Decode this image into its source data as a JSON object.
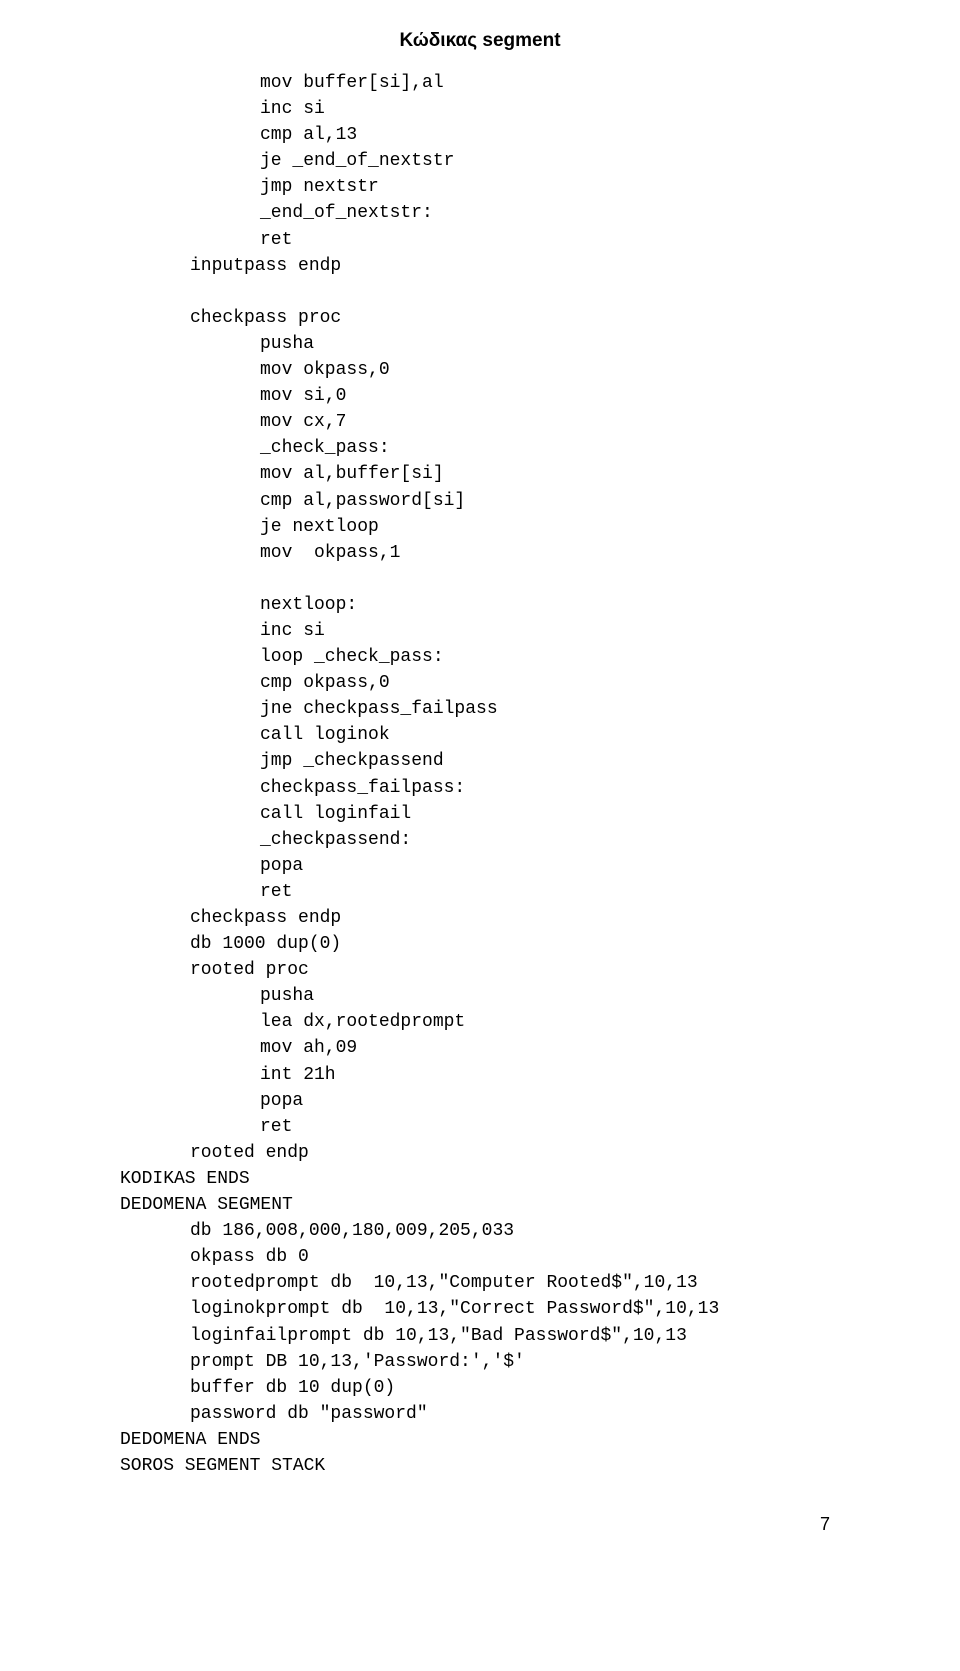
{
  "title": "Κώδικας segment",
  "lines": [
    {
      "cls": "indent2",
      "text": "mov buffer[si],al"
    },
    {
      "cls": "indent2",
      "text": "inc si"
    },
    {
      "cls": "indent2",
      "text": "cmp al,13"
    },
    {
      "cls": "indent2",
      "text": "je _end_of_nextstr"
    },
    {
      "cls": "indent2",
      "text": "jmp nextstr"
    },
    {
      "cls": "indent2",
      "text": "_end_of_nextstr:"
    },
    {
      "cls": "indent2",
      "text": "ret"
    },
    {
      "cls": "indent1",
      "text": "inputpass endp"
    },
    {
      "cls": "indent1",
      "text": ""
    },
    {
      "cls": "indent1",
      "text": "checkpass proc"
    },
    {
      "cls": "indent2",
      "text": "pusha"
    },
    {
      "cls": "indent2",
      "text": "mov okpass,0"
    },
    {
      "cls": "indent2",
      "text": "mov si,0"
    },
    {
      "cls": "indent2",
      "text": "mov cx,7"
    },
    {
      "cls": "indent2",
      "text": "_check_pass:"
    },
    {
      "cls": "indent2",
      "text": "mov al,buffer[si]"
    },
    {
      "cls": "indent2",
      "text": "cmp al,password[si]"
    },
    {
      "cls": "indent2",
      "text": "je nextloop"
    },
    {
      "cls": "indent2",
      "text": "mov  okpass,1"
    },
    {
      "cls": "indent2",
      "text": ""
    },
    {
      "cls": "indent2",
      "text": "nextloop:"
    },
    {
      "cls": "indent2",
      "text": "inc si"
    },
    {
      "cls": "indent2",
      "text": "loop _check_pass:"
    },
    {
      "cls": "indent2",
      "text": "cmp okpass,0"
    },
    {
      "cls": "indent2",
      "text": "jne checkpass_failpass"
    },
    {
      "cls": "indent2",
      "text": "call loginok"
    },
    {
      "cls": "indent2",
      "text": "jmp _checkpassend"
    },
    {
      "cls": "indent2",
      "text": "checkpass_failpass:"
    },
    {
      "cls": "indent2",
      "text": "call loginfail"
    },
    {
      "cls": "indent2",
      "text": "_checkpassend:"
    },
    {
      "cls": "indent2",
      "text": "popa"
    },
    {
      "cls": "indent2",
      "text": "ret"
    },
    {
      "cls": "indent1",
      "text": "checkpass endp"
    },
    {
      "cls": "indent1",
      "text": "db 1000 dup(0)"
    },
    {
      "cls": "indent1",
      "text": "rooted proc"
    },
    {
      "cls": "indent2",
      "text": "pusha"
    },
    {
      "cls": "indent2",
      "text": "lea dx,rootedprompt"
    },
    {
      "cls": "indent2",
      "text": "mov ah,09"
    },
    {
      "cls": "indent2",
      "text": "int 21h"
    },
    {
      "cls": "indent2",
      "text": "popa"
    },
    {
      "cls": "indent2",
      "text": "ret"
    },
    {
      "cls": "indent1",
      "text": "rooted endp"
    },
    {
      "cls": "noindent",
      "text": "KODIKAS ENDS"
    },
    {
      "cls": "noindent",
      "text": "DEDOMENA SEGMENT"
    },
    {
      "cls": "indent1",
      "text": "db 186,008,000,180,009,205,033"
    },
    {
      "cls": "indent1",
      "text": "okpass db 0"
    },
    {
      "cls": "indent1",
      "text": "rootedprompt db  10,13,\"Computer Rooted$\",10,13"
    },
    {
      "cls": "indent1",
      "text": "loginokprompt db  10,13,\"Correct Password$\",10,13"
    },
    {
      "cls": "indent1",
      "text": "loginfailprompt db 10,13,\"Bad Password$\",10,13"
    },
    {
      "cls": "indent1",
      "text": "prompt DB 10,13,'Password:','$'"
    },
    {
      "cls": "indent1",
      "text": "buffer db 10 dup(0)"
    },
    {
      "cls": "indent1",
      "text": "password db \"password\""
    },
    {
      "cls": "noindent",
      "text": "DEDOMENA ENDS"
    },
    {
      "cls": "noindent",
      "text": "SOROS SEGMENT STACK"
    }
  ],
  "pageNumber": "7"
}
